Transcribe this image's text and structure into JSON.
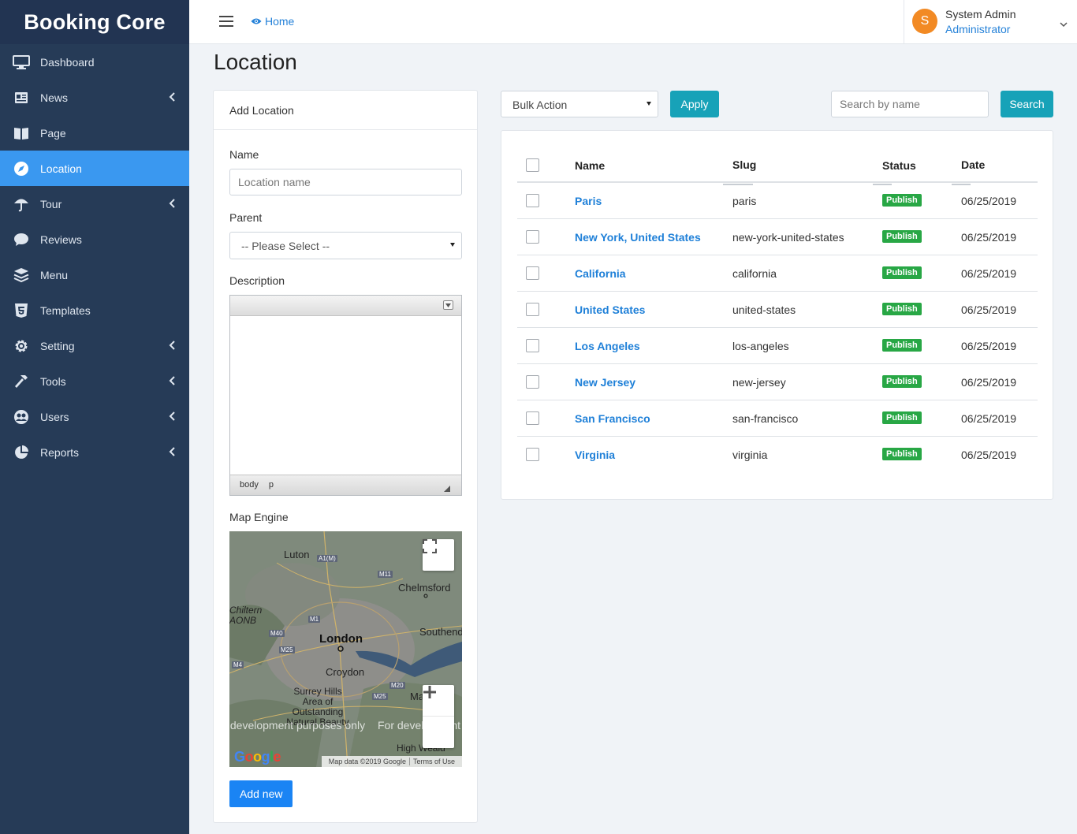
{
  "brand": "Booking Core",
  "sidebar": {
    "items": [
      {
        "label": "Dashboard",
        "icon": "monitor-icon"
      },
      {
        "label": "News",
        "icon": "newspaper-icon"
      },
      {
        "label": "Page",
        "icon": "book-icon"
      },
      {
        "label": "Location",
        "icon": "compass-icon"
      },
      {
        "label": "Tour",
        "icon": "umbrella-icon"
      },
      {
        "label": "Reviews",
        "icon": "comment-icon"
      },
      {
        "label": "Menu",
        "icon": "layers-icon"
      },
      {
        "label": "Templates",
        "icon": "html5-icon"
      },
      {
        "label": "Setting",
        "icon": "gear-icon"
      },
      {
        "label": "Tools",
        "icon": "hammer-icon"
      },
      {
        "label": "Users",
        "icon": "users-icon"
      },
      {
        "label": "Reports",
        "icon": "pie-chart-icon"
      }
    ],
    "active": "Location"
  },
  "topbar": {
    "home_label": "Home",
    "user_initial": "S",
    "user_name": "System Admin",
    "user_role": "Administrator"
  },
  "page_title": "Location",
  "add_form": {
    "header": "Add Location",
    "name_label": "Name",
    "name_placeholder": "Location name",
    "parent_label": "Parent",
    "parent_value": "-- Please Select --",
    "description_label": "Description",
    "editor_path": [
      "body",
      "p"
    ],
    "map_label": "Map Engine",
    "submit_label": "Add new"
  },
  "map": {
    "labels": [
      "Luton",
      "Chelmsford",
      "London",
      "Southend",
      "Croydon",
      "Surrey Hills Area of Outstanding Natural Beauty",
      "High Weald",
      "Chiltern AONB",
      "Maidstone"
    ],
    "roads": [
      "A1(M)",
      "M11",
      "M1",
      "M40",
      "M25",
      "M4",
      "M20",
      "M25"
    ],
    "watermark": "For development purposes only",
    "footer_data": "Map data ©2019 Google",
    "footer_terms": "Terms of Use",
    "logo": "Google"
  },
  "toolbar": {
    "bulk_action": "Bulk Action",
    "apply_label": "Apply",
    "search_placeholder": "Search by name",
    "search_label": "Search"
  },
  "table": {
    "columns": [
      "Name",
      "Slug",
      "Status",
      "Date"
    ],
    "rows": [
      {
        "name": "Paris",
        "slug": "paris",
        "status": "Publish",
        "date": "06/25/2019"
      },
      {
        "name": "New York, United States",
        "slug": "new-york-united-states",
        "status": "Publish",
        "date": "06/25/2019"
      },
      {
        "name": "California",
        "slug": "california",
        "status": "Publish",
        "date": "06/25/2019"
      },
      {
        "name": "United States",
        "slug": "united-states",
        "status": "Publish",
        "date": "06/25/2019"
      },
      {
        "name": "Los Angeles",
        "slug": "los-angeles",
        "status": "Publish",
        "date": "06/25/2019"
      },
      {
        "name": "New Jersey",
        "slug": "new-jersey",
        "status": "Publish",
        "date": "06/25/2019"
      },
      {
        "name": "San Francisco",
        "slug": "san-francisco",
        "status": "Publish",
        "date": "06/25/2019"
      },
      {
        "name": "Virginia",
        "slug": "virginia",
        "status": "Publish",
        "date": "06/25/2019"
      }
    ]
  },
  "colors": {
    "sidebar": "#263b57",
    "active": "#3a98f0",
    "link": "#1f80d8",
    "publish": "#28a745",
    "info_button": "#17a2b8",
    "primary_button": "#1a84f4"
  }
}
